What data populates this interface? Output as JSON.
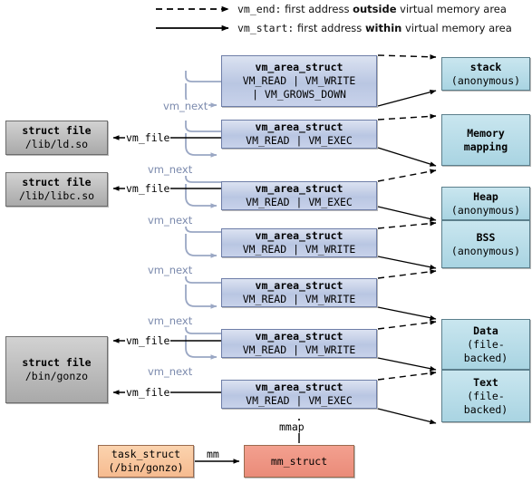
{
  "legend": {
    "vm_end": {
      "arrow": "dashed-arrow",
      "name": "vm_end:",
      "text_a": "first address ",
      "emph": "outside",
      "text_b": " virtual memory area"
    },
    "vm_start": {
      "arrow": "solid-arrow",
      "name": "vm_start:",
      "text_a": "first address ",
      "emph": "within",
      "text_b": " virtual memory area"
    }
  },
  "vm_areas": [
    {
      "title": "vm_area_struct",
      "flags_line_1": "VM_READ | VM_WRITE",
      "flags_line_2": "| VM_GROWS_DOWN"
    },
    {
      "title": "vm_area_struct",
      "flags_line_1": "VM_READ | VM_EXEC",
      "flags_line_2": ""
    },
    {
      "title": "vm_area_struct",
      "flags_line_1": "VM_READ | VM_EXEC",
      "flags_line_2": ""
    },
    {
      "title": "vm_area_struct",
      "flags_line_1": "VM_READ | VM_WRITE",
      "flags_line_2": ""
    },
    {
      "title": "vm_area_struct",
      "flags_line_1": "VM_READ | VM_WRITE",
      "flags_line_2": ""
    },
    {
      "title": "vm_area_struct",
      "flags_line_1": "VM_READ | VM_WRITE",
      "flags_line_2": ""
    },
    {
      "title": "vm_area_struct",
      "flags_line_1": "VM_READ | VM_EXEC",
      "flags_line_2": ""
    }
  ],
  "regions": [
    {
      "name": "stack",
      "kind": "(anonymous)",
      "kind2": ""
    },
    {
      "name": "Memory",
      "kind": "mapping",
      "kind2": ""
    },
    {
      "name": "Heap",
      "kind": "(anonymous)",
      "kind2": ""
    },
    {
      "name": "BSS",
      "kind": "(anonymous)",
      "kind2": ""
    },
    {
      "name": "Data",
      "kind": "(file-",
      "kind2": "backed)"
    },
    {
      "name": "Text",
      "kind": "(file-",
      "kind2": "backed)"
    }
  ],
  "struct_files": [
    {
      "title": "struct file",
      "path": "/lib/ld.so"
    },
    {
      "title": "struct file",
      "path": "/lib/libc.so"
    },
    {
      "title": "struct file",
      "path": "/bin/gonzo"
    }
  ],
  "bottom": {
    "task_struct": {
      "title": "task_struct",
      "path": "(/bin/gonzo)"
    },
    "mm_struct": {
      "title": "mm_struct"
    },
    "mm_label": "mm",
    "mmap_label": "mmap"
  },
  "links": {
    "vm_next": "vm_next",
    "vm_file": "vm_file"
  },
  "colors": {
    "vma_fill": "#b9c6e2",
    "vma_border": "#6e7ea8",
    "region_fill": "#a9d4e2",
    "region_border": "#5c7f8c",
    "file_fill": "#a9a9a9",
    "file_border": "#6d6d6d",
    "task_fill": "#f6bb90",
    "mm_fill": "#ea8b79",
    "next_label": "#7b8aad",
    "next_line": "#9aa7c4",
    "ink": "#000000"
  }
}
